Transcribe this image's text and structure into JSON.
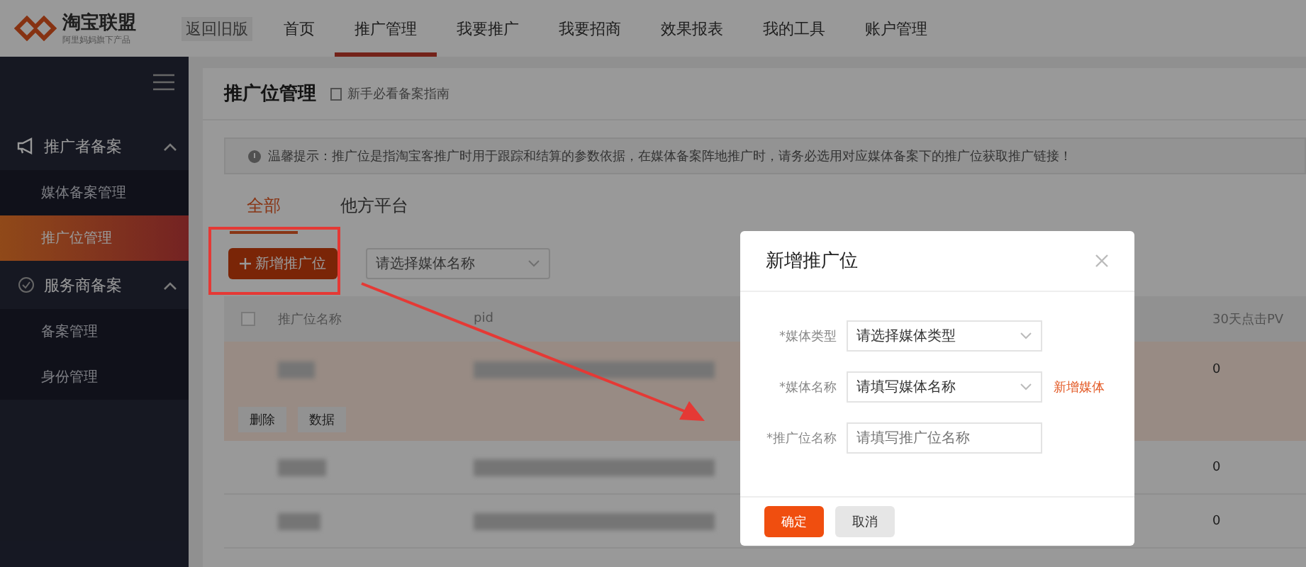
{
  "header": {
    "logo_title": "淘宝联盟",
    "logo_subtitle": "阿里妈妈旗下产品",
    "old_version": "返回旧版",
    "nav": [
      {
        "label": "首页",
        "selected": false
      },
      {
        "label": "推广管理",
        "selected": true
      },
      {
        "label": "我要推广",
        "selected": false
      },
      {
        "label": "我要招商",
        "selected": false
      },
      {
        "label": "效果报表",
        "selected": false
      },
      {
        "label": "我的工具",
        "selected": false
      },
      {
        "label": "账户管理",
        "selected": false
      }
    ]
  },
  "sidebar": {
    "groups": [
      {
        "label": "推广者备案",
        "expanded": true,
        "items": [
          {
            "label": "媒体备案管理",
            "selected": false
          },
          {
            "label": "推广位管理",
            "selected": true
          }
        ]
      },
      {
        "label": "服务商备案",
        "expanded": true,
        "items": [
          {
            "label": "备案管理",
            "selected": false
          },
          {
            "label": "身份管理",
            "selected": false
          }
        ]
      }
    ]
  },
  "page": {
    "title": "推广位管理",
    "guide_link": "新手必看备案指南",
    "notice": "温馨提示：推广位是指淘宝客推广时用于跟踪和结算的参数依据，在媒体备案阵地推广时，请务必选用对应媒体备案下的推广位获取推广链接！",
    "tabs": [
      {
        "label": "全部",
        "selected": true
      },
      {
        "label": "他方平台",
        "selected": false
      }
    ],
    "add_button": "新增推广位",
    "media_select_placeholder": "请选择媒体名称"
  },
  "table": {
    "select_all_checked": false,
    "columns": [
      "推广位名称",
      "pid",
      "30天点击PV"
    ],
    "rows": [
      {
        "pv": "0",
        "highlighted": true,
        "actions": [
          "删除",
          "数据"
        ]
      },
      {
        "pv": "0",
        "highlighted": false
      },
      {
        "pv": "0",
        "highlighted": false
      }
    ]
  },
  "dialog": {
    "title": "新增推广位",
    "fields": [
      {
        "label": "*媒体类型",
        "kind": "select",
        "placeholder": "请选择媒体类型"
      },
      {
        "label": "*媒体名称",
        "kind": "select",
        "placeholder": "请填写媒体名称",
        "link": "新增媒体"
      },
      {
        "label": "*推广位名称",
        "kind": "input",
        "placeholder": "请填写推广位名称"
      }
    ],
    "confirm": "确定",
    "cancel": "取消"
  }
}
